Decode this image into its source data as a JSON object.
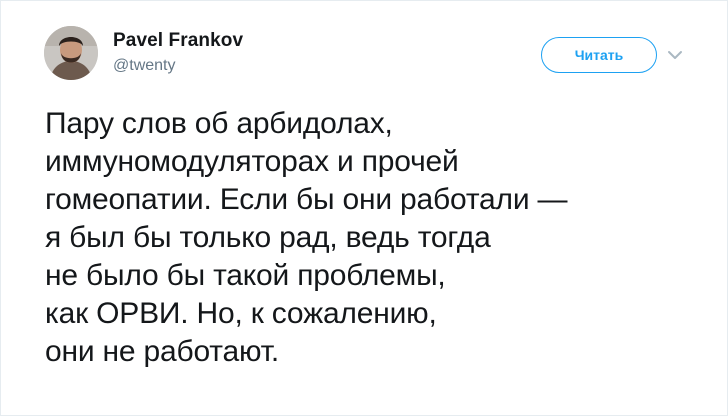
{
  "tweet": {
    "author": {
      "display_name": "Pavel Frankov",
      "handle": "@twenty"
    },
    "follow_button_label": "Читать",
    "text_lines": [
      "Пару слов об арбидолах,",
      "иммуномодуляторах и прочей",
      "гомеопатии. Если бы они работали —",
      "я был бы только рад, ведь тогда",
      "не было бы такой проблемы,",
      "как ОРВИ. Но, к сожалению,",
      "они не работают."
    ]
  },
  "colors": {
    "accent": "#1da1f2",
    "text": "#14171a",
    "muted": "#657786",
    "border": "#e6ecf0"
  },
  "icons": {
    "menu": "chevron-down-icon"
  }
}
